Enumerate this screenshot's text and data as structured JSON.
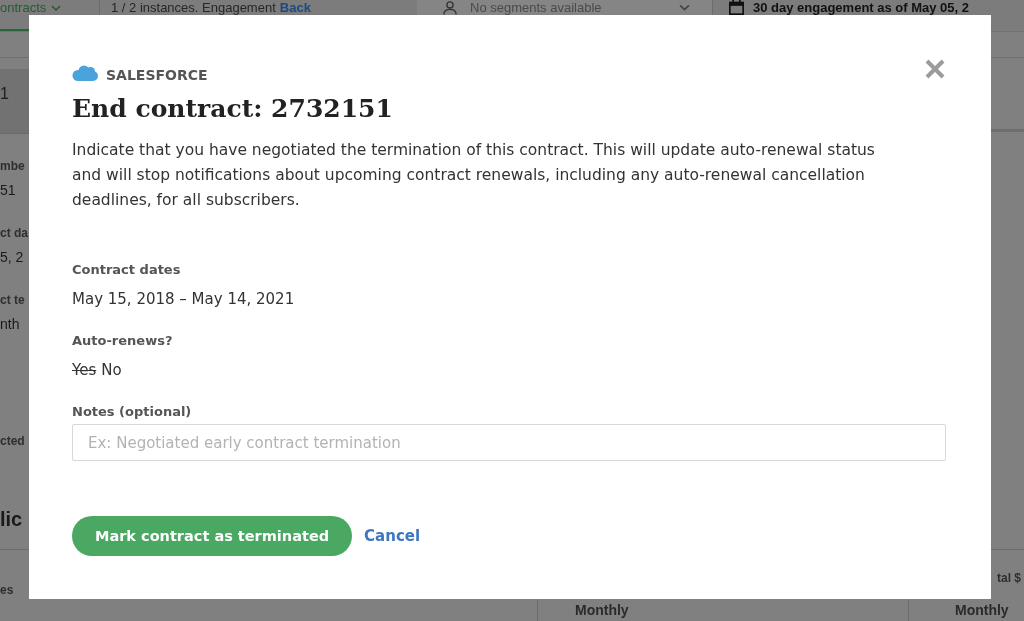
{
  "background": {
    "top_bar": {
      "tab": {
        "label": "ontracts",
        "selected": true
      },
      "instances": "1 / 2 instances. Engagement",
      "back_link": "Back",
      "segments_dropdown": "No segments available",
      "engagement": "30 day engagement as of May 05, 2"
    },
    "left_panel": {
      "band": "1",
      "fields": [
        {
          "label": "mbe",
          "value": "51"
        },
        {
          "label": "ct da",
          "value": "5, 2"
        },
        {
          "label": "ct te",
          "value": "nth"
        },
        {
          "label": "cted"
        }
      ],
      "section_heading": "lic",
      "column_header": "es"
    },
    "right_panel": {
      "column_header": "tal $"
    },
    "table_row": [
      "Monthly",
      "Monthly"
    ]
  },
  "dialog": {
    "source": "SALESFORCE",
    "title": "End contract: 2732151",
    "description": "Indicate that you have negotiated the termination of this contract. This will update auto-renewal status and will stop notifications about upcoming contract renewals, including any auto-renewal cancellation deadlines, for all subscribers.",
    "fields": [
      {
        "kind": "text",
        "label": "Contract dates",
        "value": "May 15, 2018 – May 14, 2021"
      },
      {
        "kind": "choice",
        "label": "Auto-renews?",
        "options": [
          {
            "label": "Yes",
            "struck": true
          },
          {
            "label": "No",
            "struck": false
          }
        ]
      },
      {
        "kind": "input",
        "label": "Notes (optional)",
        "placeholder": "Ex: Negotiated early contract termination"
      }
    ],
    "submit_button": "Mark contract as terminated",
    "cancel_link": "Cancel"
  }
}
